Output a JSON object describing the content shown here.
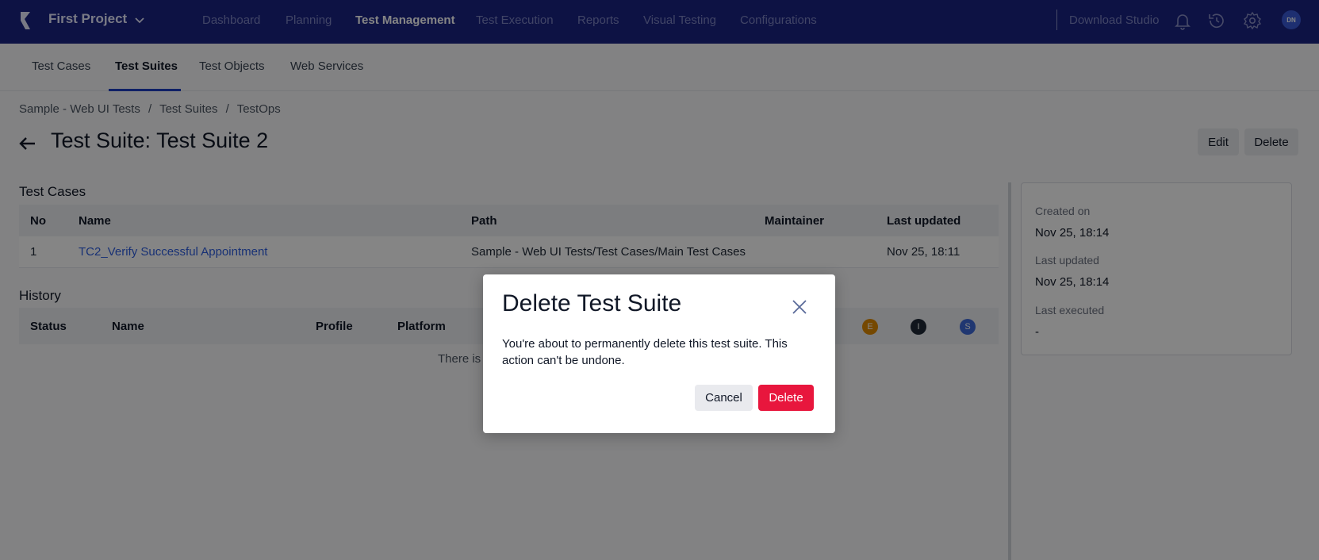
{
  "topnav": {
    "project": "First Project",
    "items": [
      "Dashboard",
      "Planning",
      "Test Management",
      "Test Execution",
      "Reports",
      "Visual Testing",
      "Configurations"
    ],
    "active_item": "Test Management",
    "download_label": "Download Studio",
    "avatar_initials": "DN",
    "icons": [
      "bell-icon",
      "history-icon",
      "settings-icon"
    ]
  },
  "subtabs": {
    "items": [
      "Test Cases",
      "Test Suites",
      "Test Objects",
      "Web Services"
    ],
    "active": "Test Suites"
  },
  "breadcrumb": [
    "Sample - Web UI Tests",
    "/",
    "Test Suites",
    "/",
    "TestOps"
  ],
  "page": {
    "title": "Test Suite: Test Suite 2",
    "edit_label": "Edit",
    "delete_label": "Delete"
  },
  "test_cases": {
    "title": "Test Cases",
    "columns": [
      "No",
      "Name",
      "Path",
      "Maintainer",
      "Last updated"
    ],
    "rows": [
      {
        "no": "1",
        "name": "TC2_Verify Successful Appointment",
        "path": "Sample - Web UI Tests/Test Cases/Main Test Cases",
        "maintainer": "",
        "updated": "Nov 25, 18:11"
      }
    ]
  },
  "history": {
    "title": "History",
    "columns": [
      "Status",
      "Name",
      "Profile",
      "Platform"
    ],
    "status_badges": [
      "E",
      "I",
      "S"
    ],
    "empty_partial": "There is"
  },
  "side": {
    "created_label": "Created on",
    "created_value": "Nov 25, 18:14",
    "updated_label": "Last updated",
    "updated_value": "Nov 25, 18:14",
    "executed_label": "Last executed",
    "executed_value": "-"
  },
  "modal": {
    "title": "Delete Test Suite",
    "body": "You're about to permanently delete this test suite. This action can't be undone.",
    "cancel_label": "Cancel",
    "delete_label": "Delete"
  },
  "colors": {
    "nav_bg": "#1a2383",
    "accent": "#2f5fe0",
    "danger": "#e8163d"
  }
}
